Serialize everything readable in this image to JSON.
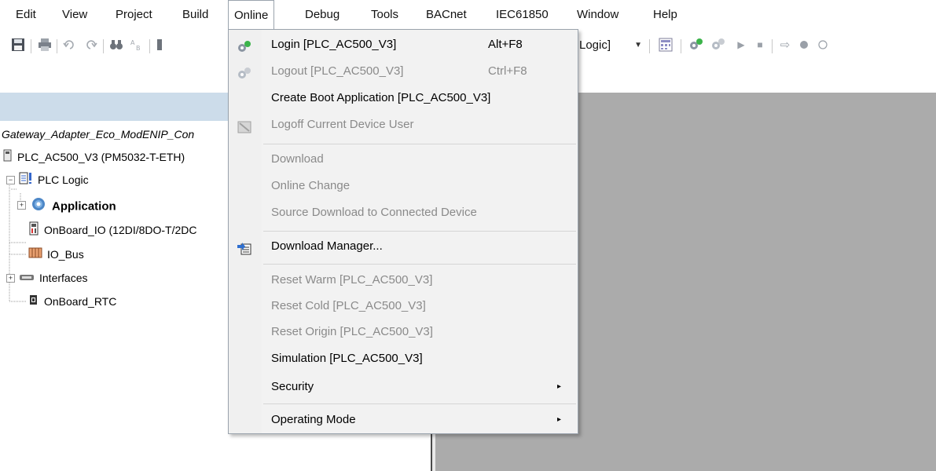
{
  "menubar": {
    "items": [
      "Edit",
      "View",
      "Project",
      "Build",
      "Online",
      "Debug",
      "Tools",
      "BACnet",
      "IEC61850",
      "Window",
      "Help"
    ]
  },
  "toolbar": {
    "combo_text": "Logic]"
  },
  "tree": {
    "root": "Gateway_Adapter_Eco_ModENIP_Con",
    "device": "PLC_AC500_V3 (PM5032-T-ETH)",
    "plc_logic": "PLC Logic",
    "application": "Application",
    "onboard_io": "OnBoard_IO (12DI/8DO-T/2DC",
    "io_bus": "IO_Bus",
    "interfaces": "Interfaces",
    "onboard_rtc": "OnBoard_RTC"
  },
  "online_menu": {
    "items": [
      {
        "label": "Login [PLC_AC500_V3]",
        "shortcut": "Alt+F8",
        "enabled": true,
        "icon": "login-icon"
      },
      {
        "label": "Logout [PLC_AC500_V3]",
        "shortcut": "Ctrl+F8",
        "enabled": false,
        "icon": "logout-icon"
      },
      {
        "label": "Create Boot Application [PLC_AC500_V3]",
        "enabled": true
      },
      {
        "label": "Logoff Current Device User",
        "enabled": false,
        "icon": "logoff-user-icon"
      },
      {
        "label": "Download",
        "enabled": false
      },
      {
        "label": "Online Change",
        "enabled": false
      },
      {
        "label": "Source Download to Connected Device",
        "enabled": false
      },
      {
        "label": "Download Manager...",
        "enabled": true,
        "icon": "download-manager-icon"
      },
      {
        "label": "Reset Warm [PLC_AC500_V3]",
        "enabled": false
      },
      {
        "label": "Reset Cold [PLC_AC500_V3]",
        "enabled": false
      },
      {
        "label": "Reset Origin [PLC_AC500_V3]",
        "enabled": false
      },
      {
        "label": "Simulation [PLC_AC500_V3]",
        "enabled": true
      },
      {
        "label": "Security",
        "enabled": true,
        "submenu": true
      },
      {
        "label": "Operating Mode",
        "enabled": true,
        "submenu": true
      }
    ],
    "submenu_arrow": "▸"
  },
  "colors": {
    "panel_header": "#ccdcea",
    "editor_area": "#ababab",
    "menu_bg": "#f2f2f2",
    "disabled_text": "#8a8a8a"
  }
}
